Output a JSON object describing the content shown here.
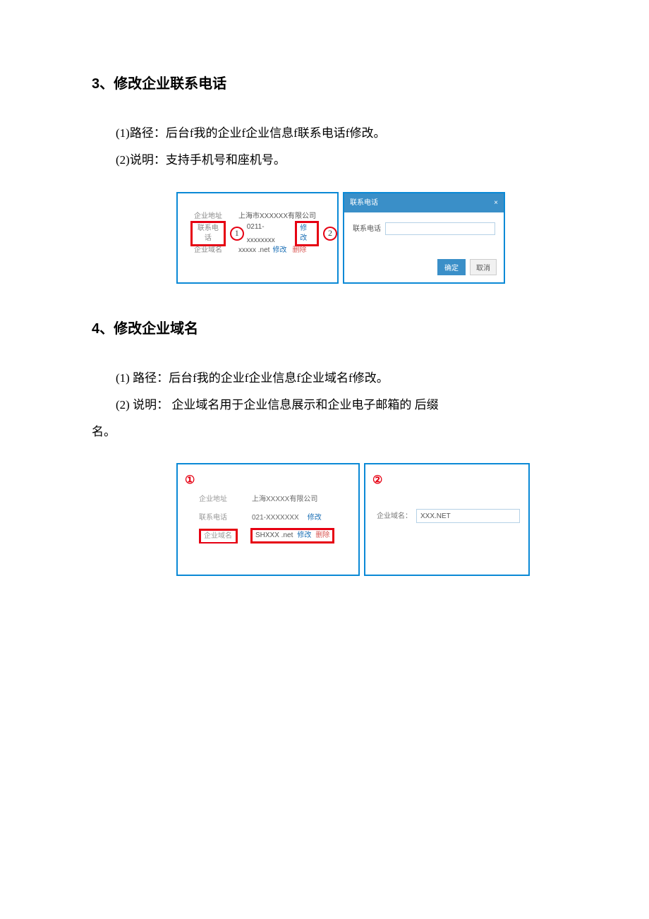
{
  "section3": {
    "heading": "3、修改企业联系电话",
    "p1": "(1)路径：后台f我的企业f企业信息f联系电话f修改。",
    "p2": "(2)说明：支持手机号和座机号。",
    "fig": {
      "left": {
        "r1label": "企业地址",
        "r1value": "上海市XXXXXX有限公司",
        "r2label": "联系电话",
        "circle1": "1",
        "r2value": "0211-xxxxxxxx",
        "r2edit": "修改",
        "circle2": "2",
        "r3label": "企业域名",
        "r3value": "xxxxx .net",
        "r3edit": "修改",
        "r3del": "删除"
      },
      "right": {
        "title": "联系电话",
        "close": "×",
        "label": "联系电话",
        "input": "",
        "ok": "确定",
        "cancel": "取消"
      }
    }
  },
  "section4": {
    "heading": "4、修改企业域名",
    "p1": "(1)  路径：后台f我的企业f企业信息f企业域名f修改。",
    "p2": "(2)  说明：  企业域名用于企业信息展示和企业电子邮箱的  后缀",
    "p2b": "名。",
    "fig": {
      "left": {
        "circle": "①",
        "r1label": "企业地址",
        "r1value": "上海XXXXX有限公司",
        "r2label": "联系电话",
        "r2value": "021-XXXXXXX",
        "r2edit": "修改",
        "r3label": "企业域名",
        "r3value": "SHXXX .net",
        "r3edit": "修改",
        "r3del": "删除"
      },
      "right": {
        "circle": "②",
        "label": "企业域名：",
        "input": "XXX.NET"
      }
    }
  }
}
